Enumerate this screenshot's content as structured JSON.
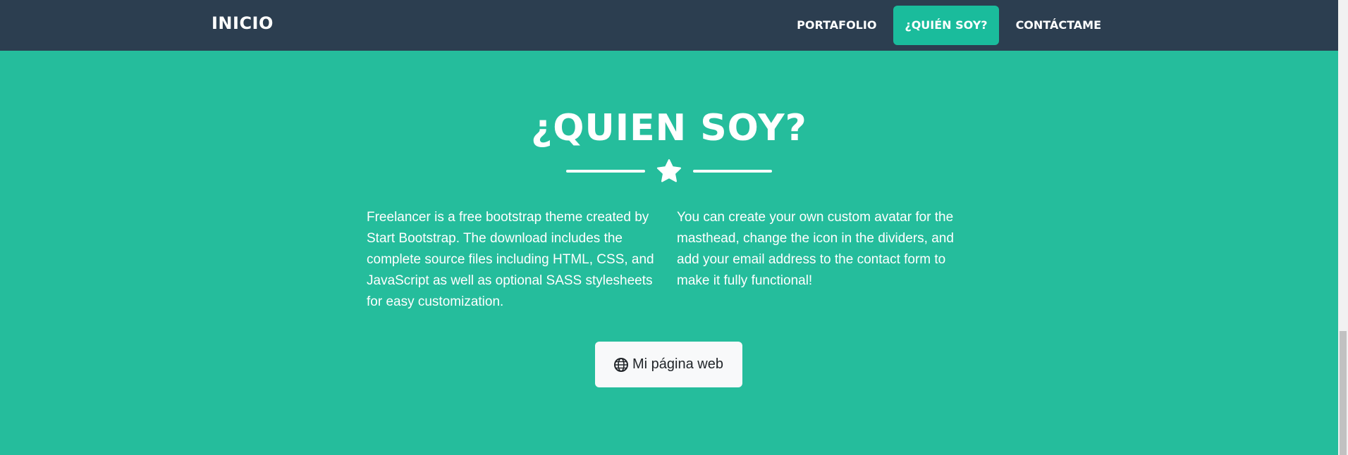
{
  "nav": {
    "brand": "INICIO",
    "links": [
      {
        "label": "PORTAFOLIO"
      },
      {
        "label": "¿QUIÉN SOY?"
      },
      {
        "label": "CONTÁCTAME"
      }
    ]
  },
  "about": {
    "title": "¿QUIEN SOY?",
    "divider_icon": "star-icon",
    "paragraph_left": "Freelancer is a free bootstrap theme created by Start Bootstrap. The download includes the complete source files including HTML, CSS, and JavaScript as well as optional SASS stylesheets for easy customization.",
    "paragraph_right": "You can create your own custom avatar for the masthead, change the icon in the dividers, and add your email address to the contact form to make it fully functional!",
    "button_label": "Mi página web",
    "button_icon": "globe-icon"
  },
  "colors": {
    "navbar": "#2c3e50",
    "accent": "#1abc9c",
    "button_bg": "#f8f9fa"
  }
}
